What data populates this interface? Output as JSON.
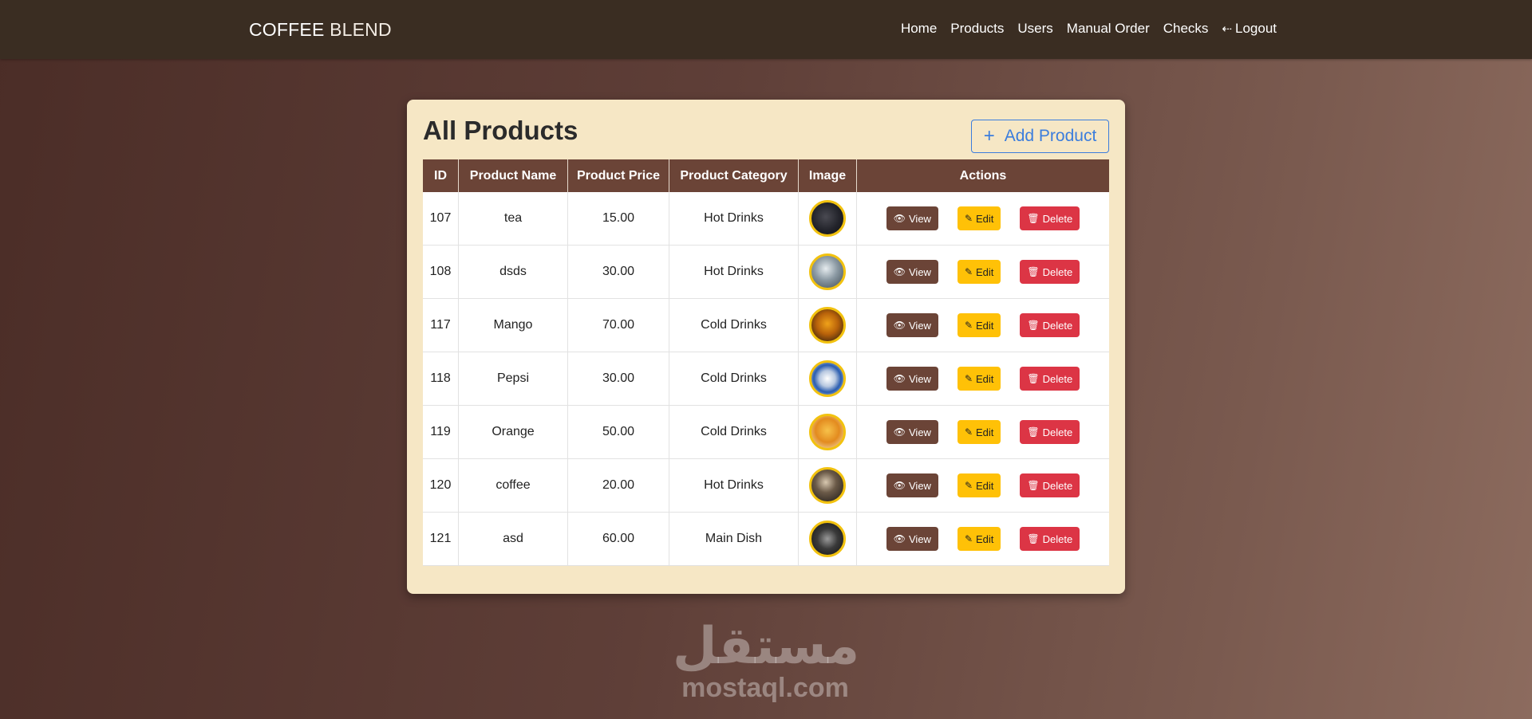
{
  "navbar": {
    "brand_part1": "COFFEE",
    "brand_part2": "BLEND",
    "links": [
      "Home",
      "Products",
      "Users",
      "Manual Order",
      "Checks"
    ],
    "logout_label": "Logout"
  },
  "card": {
    "title": "All Products",
    "add_button_label": "Add Product"
  },
  "table": {
    "headers": [
      "ID",
      "Product Name",
      "Product Price",
      "Product Category",
      "Image",
      "Actions"
    ],
    "rows": [
      {
        "id": "107",
        "name": "tea",
        "price": "15.00",
        "category": "Hot Drinks"
      },
      {
        "id": "108",
        "name": "dsds",
        "price": "30.00",
        "category": "Hot Drinks"
      },
      {
        "id": "117",
        "name": "Mango",
        "price": "70.00",
        "category": "Cold Drinks"
      },
      {
        "id": "118",
        "name": "Pepsi",
        "price": "30.00",
        "category": "Cold Drinks"
      },
      {
        "id": "119",
        "name": "Orange",
        "price": "50.00",
        "category": "Cold Drinks"
      },
      {
        "id": "120",
        "name": "coffee",
        "price": "20.00",
        "category": "Hot Drinks"
      },
      {
        "id": "121",
        "name": "asd",
        "price": "60.00",
        "category": "Main Dish"
      }
    ],
    "action_labels": {
      "view": "View",
      "edit": "Edit",
      "delete": "Delete"
    }
  },
  "watermark": {
    "arabic": "مستقل",
    "latin": "mostaql.com"
  },
  "colors": {
    "navbar": "#3a2d22",
    "card": "#f6e7c5",
    "table_header": "#6b4437",
    "view_button": "#6b4437",
    "edit_button": "#ffc107",
    "delete_button": "#dc3545",
    "add_button": "#3b7ddd",
    "thumb_border": "#f2c20f"
  },
  "icons": {
    "logout": "logout-icon",
    "add": "plus-icon",
    "view": "eye-icon",
    "edit": "pencil-icon",
    "delete": "trash-icon"
  }
}
